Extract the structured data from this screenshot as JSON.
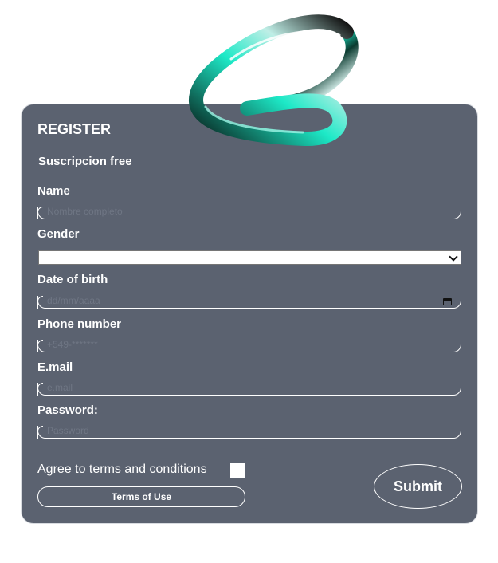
{
  "form": {
    "title": "REGISTER",
    "subtitle": "Suscripcion free",
    "fields": [
      {
        "label": "Name",
        "placeholder": "Nombre completo"
      },
      {
        "label": "Gender",
        "selected": ""
      },
      {
        "label": "Date of birth",
        "placeholder": "dd/mm/aaaa"
      },
      {
        "label": "Phone number",
        "placeholder": "+549-*******"
      },
      {
        "label": "E.mail",
        "placeholder": "e.mail"
      },
      {
        "label": "Password:",
        "placeholder": "Password"
      }
    ],
    "agree_label": "Agree to terms and conditions",
    "terms_button": "Terms of Use",
    "submit_button": "Submit"
  },
  "icons": {
    "logo": "chrome-loop-logo-icon",
    "calendar": "calendar-icon",
    "dropdown": "chevron-down-icon"
  },
  "colors": {
    "card_background": "#5b6270",
    "text": "#ffffff",
    "placeholder": "#6f7684",
    "logo_accent": "#1de9c7"
  }
}
